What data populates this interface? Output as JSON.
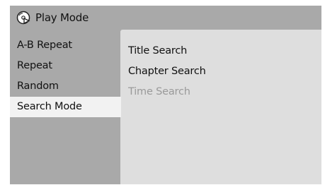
{
  "header": {
    "title": "Play Mode",
    "icon": "play-mode-disc-icon"
  },
  "left_menu": {
    "items": [
      {
        "label": "A-B Repeat",
        "selected": false
      },
      {
        "label": "Repeat",
        "selected": false
      },
      {
        "label": "Random",
        "selected": false
      },
      {
        "label": "Search Mode",
        "selected": true
      }
    ]
  },
  "submenu": {
    "items": [
      {
        "label": "Title Search",
        "enabled": true
      },
      {
        "label": "Chapter Search",
        "enabled": true
      },
      {
        "label": "Time Search",
        "enabled": false
      }
    ]
  },
  "colors": {
    "background": "#a9a9a9",
    "panel": "#dedede",
    "selected": "#f2f2f2",
    "disabled_text": "#9a9a9a"
  }
}
